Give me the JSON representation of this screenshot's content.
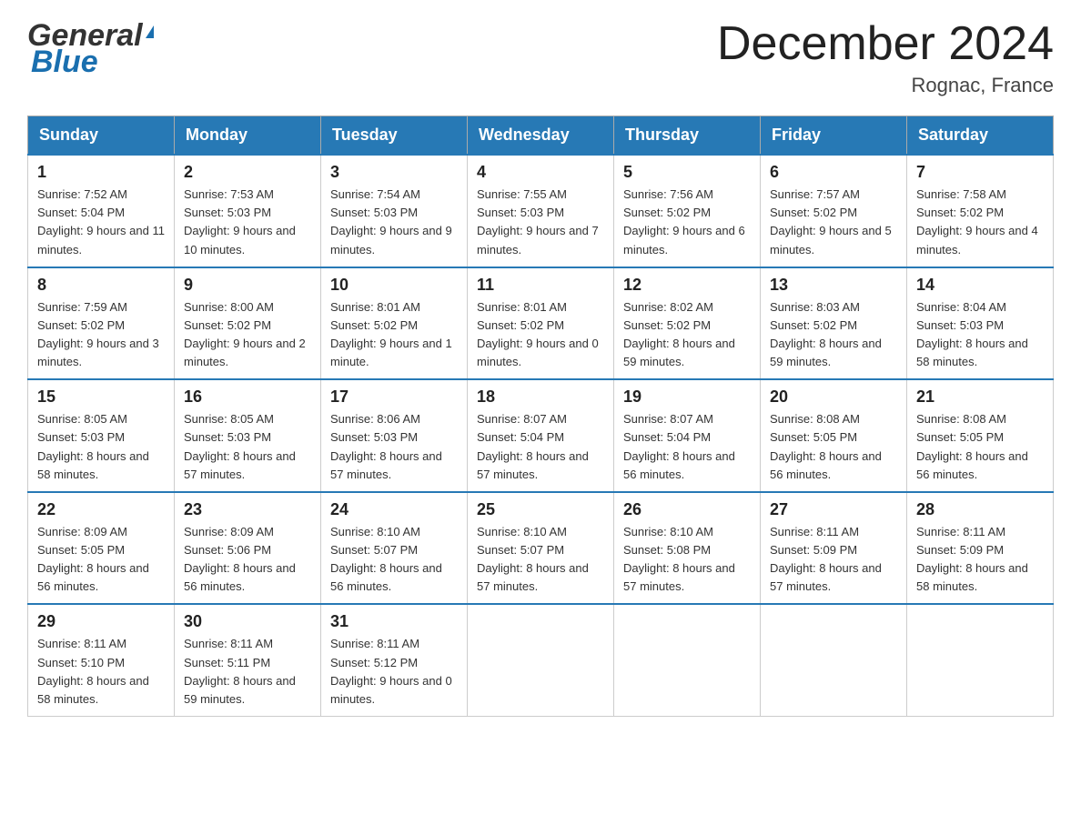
{
  "header": {
    "logo_general": "General",
    "logo_blue": "Blue",
    "title": "December 2024",
    "location": "Rognac, France"
  },
  "days_of_week": [
    "Sunday",
    "Monday",
    "Tuesday",
    "Wednesday",
    "Thursday",
    "Friday",
    "Saturday"
  ],
  "weeks": [
    [
      {
        "day": "1",
        "sunrise": "7:52 AM",
        "sunset": "5:04 PM",
        "daylight": "9 hours and 11 minutes."
      },
      {
        "day": "2",
        "sunrise": "7:53 AM",
        "sunset": "5:03 PM",
        "daylight": "9 hours and 10 minutes."
      },
      {
        "day": "3",
        "sunrise": "7:54 AM",
        "sunset": "5:03 PM",
        "daylight": "9 hours and 9 minutes."
      },
      {
        "day": "4",
        "sunrise": "7:55 AM",
        "sunset": "5:03 PM",
        "daylight": "9 hours and 7 minutes."
      },
      {
        "day": "5",
        "sunrise": "7:56 AM",
        "sunset": "5:02 PM",
        "daylight": "9 hours and 6 minutes."
      },
      {
        "day": "6",
        "sunrise": "7:57 AM",
        "sunset": "5:02 PM",
        "daylight": "9 hours and 5 minutes."
      },
      {
        "day": "7",
        "sunrise": "7:58 AM",
        "sunset": "5:02 PM",
        "daylight": "9 hours and 4 minutes."
      }
    ],
    [
      {
        "day": "8",
        "sunrise": "7:59 AM",
        "sunset": "5:02 PM",
        "daylight": "9 hours and 3 minutes."
      },
      {
        "day": "9",
        "sunrise": "8:00 AM",
        "sunset": "5:02 PM",
        "daylight": "9 hours and 2 minutes."
      },
      {
        "day": "10",
        "sunrise": "8:01 AM",
        "sunset": "5:02 PM",
        "daylight": "9 hours and 1 minute."
      },
      {
        "day": "11",
        "sunrise": "8:01 AM",
        "sunset": "5:02 PM",
        "daylight": "9 hours and 0 minutes."
      },
      {
        "day": "12",
        "sunrise": "8:02 AM",
        "sunset": "5:02 PM",
        "daylight": "8 hours and 59 minutes."
      },
      {
        "day": "13",
        "sunrise": "8:03 AM",
        "sunset": "5:02 PM",
        "daylight": "8 hours and 59 minutes."
      },
      {
        "day": "14",
        "sunrise": "8:04 AM",
        "sunset": "5:03 PM",
        "daylight": "8 hours and 58 minutes."
      }
    ],
    [
      {
        "day": "15",
        "sunrise": "8:05 AM",
        "sunset": "5:03 PM",
        "daylight": "8 hours and 58 minutes."
      },
      {
        "day": "16",
        "sunrise": "8:05 AM",
        "sunset": "5:03 PM",
        "daylight": "8 hours and 57 minutes."
      },
      {
        "day": "17",
        "sunrise": "8:06 AM",
        "sunset": "5:03 PM",
        "daylight": "8 hours and 57 minutes."
      },
      {
        "day": "18",
        "sunrise": "8:07 AM",
        "sunset": "5:04 PM",
        "daylight": "8 hours and 57 minutes."
      },
      {
        "day": "19",
        "sunrise": "8:07 AM",
        "sunset": "5:04 PM",
        "daylight": "8 hours and 56 minutes."
      },
      {
        "day": "20",
        "sunrise": "8:08 AM",
        "sunset": "5:05 PM",
        "daylight": "8 hours and 56 minutes."
      },
      {
        "day": "21",
        "sunrise": "8:08 AM",
        "sunset": "5:05 PM",
        "daylight": "8 hours and 56 minutes."
      }
    ],
    [
      {
        "day": "22",
        "sunrise": "8:09 AM",
        "sunset": "5:05 PM",
        "daylight": "8 hours and 56 minutes."
      },
      {
        "day": "23",
        "sunrise": "8:09 AM",
        "sunset": "5:06 PM",
        "daylight": "8 hours and 56 minutes."
      },
      {
        "day": "24",
        "sunrise": "8:10 AM",
        "sunset": "5:07 PM",
        "daylight": "8 hours and 56 minutes."
      },
      {
        "day": "25",
        "sunrise": "8:10 AM",
        "sunset": "5:07 PM",
        "daylight": "8 hours and 57 minutes."
      },
      {
        "day": "26",
        "sunrise": "8:10 AM",
        "sunset": "5:08 PM",
        "daylight": "8 hours and 57 minutes."
      },
      {
        "day": "27",
        "sunrise": "8:11 AM",
        "sunset": "5:09 PM",
        "daylight": "8 hours and 57 minutes."
      },
      {
        "day": "28",
        "sunrise": "8:11 AM",
        "sunset": "5:09 PM",
        "daylight": "8 hours and 58 minutes."
      }
    ],
    [
      {
        "day": "29",
        "sunrise": "8:11 AM",
        "sunset": "5:10 PM",
        "daylight": "8 hours and 58 minutes."
      },
      {
        "day": "30",
        "sunrise": "8:11 AM",
        "sunset": "5:11 PM",
        "daylight": "8 hours and 59 minutes."
      },
      {
        "day": "31",
        "sunrise": "8:11 AM",
        "sunset": "5:12 PM",
        "daylight": "9 hours and 0 minutes."
      },
      null,
      null,
      null,
      null
    ]
  ],
  "labels": {
    "sunrise": "Sunrise:",
    "sunset": "Sunset:",
    "daylight": "Daylight:"
  }
}
